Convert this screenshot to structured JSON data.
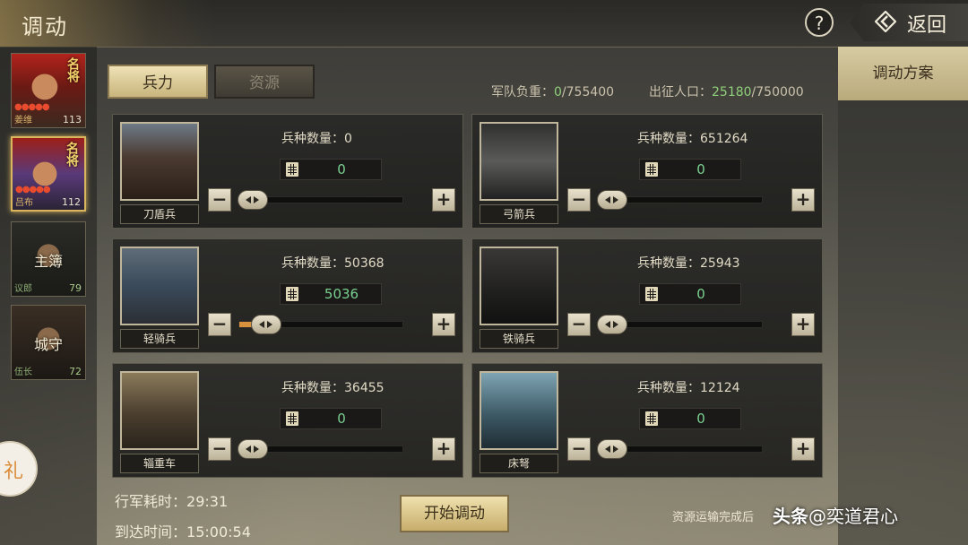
{
  "header": {
    "title": "调动",
    "help": "?",
    "back_label": "返回"
  },
  "sidebar": {
    "heroes": [
      {
        "badge": "名将",
        "stars": "●●●●●",
        "name": "姜维",
        "level": "113"
      },
      {
        "badge": "名将",
        "stars": "●●●●●",
        "name": "吕布",
        "level": "112"
      }
    ],
    "officers": [
      {
        "role": "主簿",
        "title": "议郎",
        "level": "79"
      },
      {
        "role": "城守",
        "title": "伍长",
        "level": "72"
      }
    ],
    "badge_glyph": "礼"
  },
  "tabs": {
    "troops": "兵力",
    "resources": "资源"
  },
  "stats": {
    "army_load_label": "军队负重：",
    "army_load_current": "0",
    "army_load_max": "/755400",
    "population_label": "出征人口：",
    "population_current": "25180",
    "population_max": "/750000"
  },
  "right_panel": {
    "plan_tab": "调动方案"
  },
  "units": [
    {
      "name": "刀盾兵",
      "count_label": "兵种数量：",
      "count": "0",
      "value": "0",
      "fraction": 0
    },
    {
      "name": "弓箭兵",
      "count_label": "兵种数量：",
      "count": "651264",
      "value": "0",
      "fraction": 0
    },
    {
      "name": "轻骑兵",
      "count_label": "兵种数量：",
      "count": "50368",
      "value": "5036",
      "fraction": 0.1
    },
    {
      "name": "铁骑兵",
      "count_label": "兵种数量：",
      "count": "25943",
      "value": "0",
      "fraction": 0
    },
    {
      "name": "辎重车",
      "count_label": "兵种数量：",
      "count": "36455",
      "value": "0",
      "fraction": 0
    },
    {
      "name": "床弩",
      "count_label": "兵种数量：",
      "count": "12124",
      "value": "0",
      "fraction": 0
    }
  ],
  "bottom": {
    "march_time_label": "行军耗时：",
    "march_time": "29:31",
    "arrival_label": "到达时间：",
    "arrival_time": "15:00:54",
    "start_button": "开始调动",
    "footnote": "资源运输完成后"
  },
  "watermark": {
    "brand": "头条",
    "handle": "@奕道君心"
  }
}
